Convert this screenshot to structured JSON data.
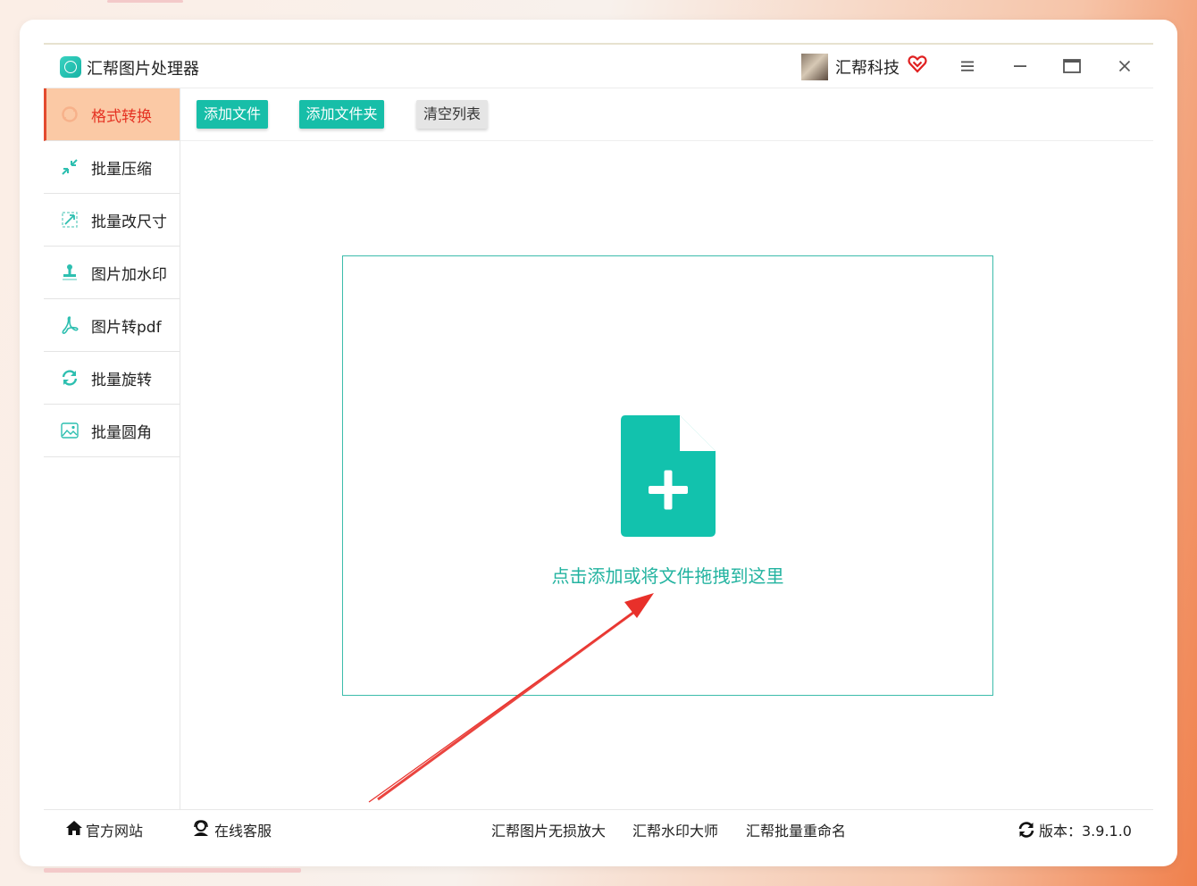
{
  "app": {
    "title": "汇帮图片处理器",
    "user_name": "汇帮科技"
  },
  "icons": {
    "logo": "app-logo-icon",
    "vip": "vip-heart-icon",
    "menu": "hamburger-menu-icon",
    "minimize": "minimize-icon",
    "maximize": "maximize-icon",
    "close": "close-icon"
  },
  "colors": {
    "accent": "#17bea8",
    "active_bg": "#fbc9a5",
    "active_text": "#e53424",
    "arrow": "#e8302a"
  },
  "sidebar": {
    "items": [
      {
        "label": "格式转换",
        "icon": "format-convert-icon",
        "active": true
      },
      {
        "label": "批量压缩",
        "icon": "compress-icon",
        "active": false
      },
      {
        "label": "批量改尺寸",
        "icon": "resize-icon",
        "active": false
      },
      {
        "label": "图片加水印",
        "icon": "watermark-stamp-icon",
        "active": false
      },
      {
        "label": "图片转pdf",
        "icon": "pdf-icon",
        "active": false
      },
      {
        "label": "批量旋转",
        "icon": "rotate-icon",
        "active": false
      },
      {
        "label": "批量圆角",
        "icon": "rounded-corner-image-icon",
        "active": false
      }
    ]
  },
  "toolbar": {
    "add_file": "添加文件",
    "add_folder": "添加文件夹",
    "clear_list": "清空列表"
  },
  "dropzone": {
    "text": "点击添加或将文件拖拽到这里",
    "icon": "file-add-icon"
  },
  "footer": {
    "website": "官方网站",
    "support": "在线客服",
    "link1": "汇帮图片无损放大",
    "link2": "汇帮水印大师",
    "link3": "汇帮批量重命名",
    "version": "版本：3.9.1.0"
  }
}
